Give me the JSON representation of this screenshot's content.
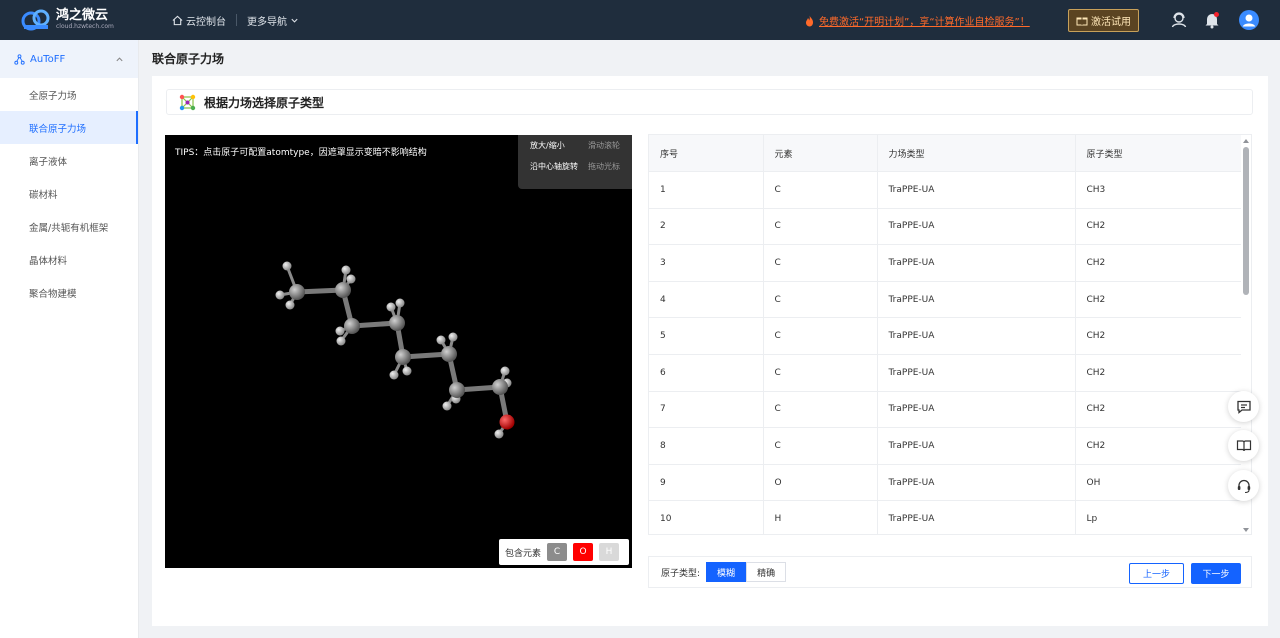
{
  "app": {
    "name": "鸿之微云",
    "domain": "cloud.hzwtech.com"
  },
  "topbar": {
    "console": "云控制台",
    "more_nav": "更多导航",
    "promo": "免费激活“开明计划”，享“计算作业自检服务”！",
    "activate": "激活试用"
  },
  "sidebar": {
    "group": "AuToFF",
    "items": [
      {
        "label": "全原子力场"
      },
      {
        "label": "联合原子力场"
      },
      {
        "label": "离子液体"
      },
      {
        "label": "碳材料"
      },
      {
        "label": "金属/共轭有机框架"
      },
      {
        "label": "晶体材料"
      },
      {
        "label": "聚合物建模"
      }
    ]
  },
  "page": {
    "title": "联合原子力场",
    "section_title": "根据力场选择原子类型"
  },
  "viewer": {
    "tips": "TIPS：点击原子可配置atomtype，因遮罩显示变暗不影响结构",
    "help": [
      {
        "action": "放大/缩小",
        "how": "滑动滚轮"
      },
      {
        "action": "沿中心轴旋转",
        "how": "拖动光标"
      }
    ],
    "legend_label": "包含元素",
    "elements": [
      {
        "symbol": "C",
        "color": "#8c8c8c"
      },
      {
        "symbol": "O",
        "color": "#ff0000"
      },
      {
        "symbol": "H",
        "color": "#d9d9d9"
      }
    ]
  },
  "table": {
    "headers": [
      "序号",
      "元素",
      "力场类型",
      "原子类型"
    ],
    "rows": [
      [
        "1",
        "C",
        "TraPPE-UA",
        "CH3"
      ],
      [
        "2",
        "C",
        "TraPPE-UA",
        "CH2"
      ],
      [
        "3",
        "C",
        "TraPPE-UA",
        "CH2"
      ],
      [
        "4",
        "C",
        "TraPPE-UA",
        "CH2"
      ],
      [
        "5",
        "C",
        "TraPPE-UA",
        "CH2"
      ],
      [
        "6",
        "C",
        "TraPPE-UA",
        "CH2"
      ],
      [
        "7",
        "C",
        "TraPPE-UA",
        "CH2"
      ],
      [
        "8",
        "C",
        "TraPPE-UA",
        "CH2"
      ],
      [
        "9",
        "O",
        "TraPPE-UA",
        "OH"
      ],
      [
        "10",
        "H",
        "TraPPE-UA",
        "Lp"
      ]
    ]
  },
  "controls": {
    "atom_type_label": "原子类型:",
    "modes": [
      {
        "label": "模糊",
        "selected": true
      },
      {
        "label": "精确",
        "selected": false
      }
    ],
    "prev": "上一步",
    "next": "下一步"
  },
  "colors": {
    "accent": "#1463ff",
    "topbar": "#1f2d3d",
    "promo": "#ff6a2a"
  },
  "icons": [
    "cloud-logo-icon",
    "home-icon",
    "chevron-down-icon",
    "fire-icon",
    "gift-icon",
    "user-service-icon",
    "bell-icon",
    "avatar-icon",
    "chat-icon",
    "book-icon",
    "headset-icon"
  ]
}
